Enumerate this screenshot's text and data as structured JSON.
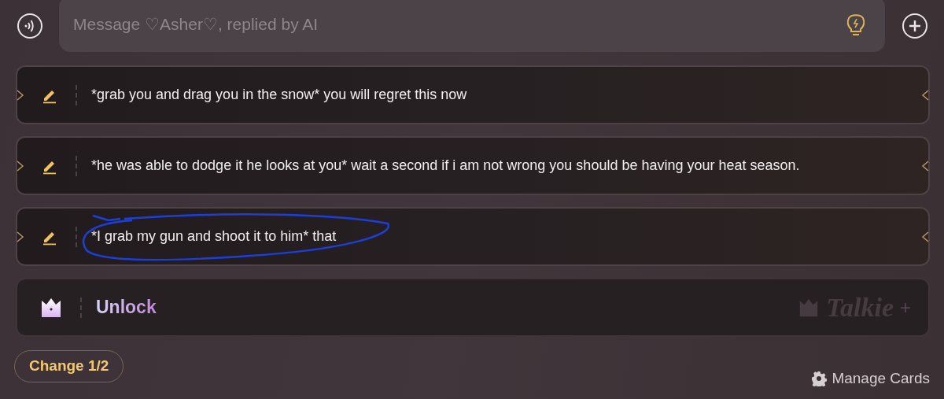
{
  "input": {
    "placeholder": "Message ♡Asher♡, replied by AI"
  },
  "cards": [
    {
      "kind": "reply",
      "text": "*grab you and drag you in the snow* you will regret this now",
      "annotated": false
    },
    {
      "kind": "reply",
      "text": "*he was able to dodge it he looks at you* wait a second if i am not wrong you should be having your heat season.",
      "annotated": false
    },
    {
      "kind": "reply",
      "text": "*I grab my gun and shoot it to him* that",
      "annotated": true
    },
    {
      "kind": "unlock",
      "text": "Unlock",
      "brand": "Talkie",
      "brand_mark": "+"
    }
  ],
  "change_button": "Change 1/2",
  "manage_link": "Manage Cards"
}
